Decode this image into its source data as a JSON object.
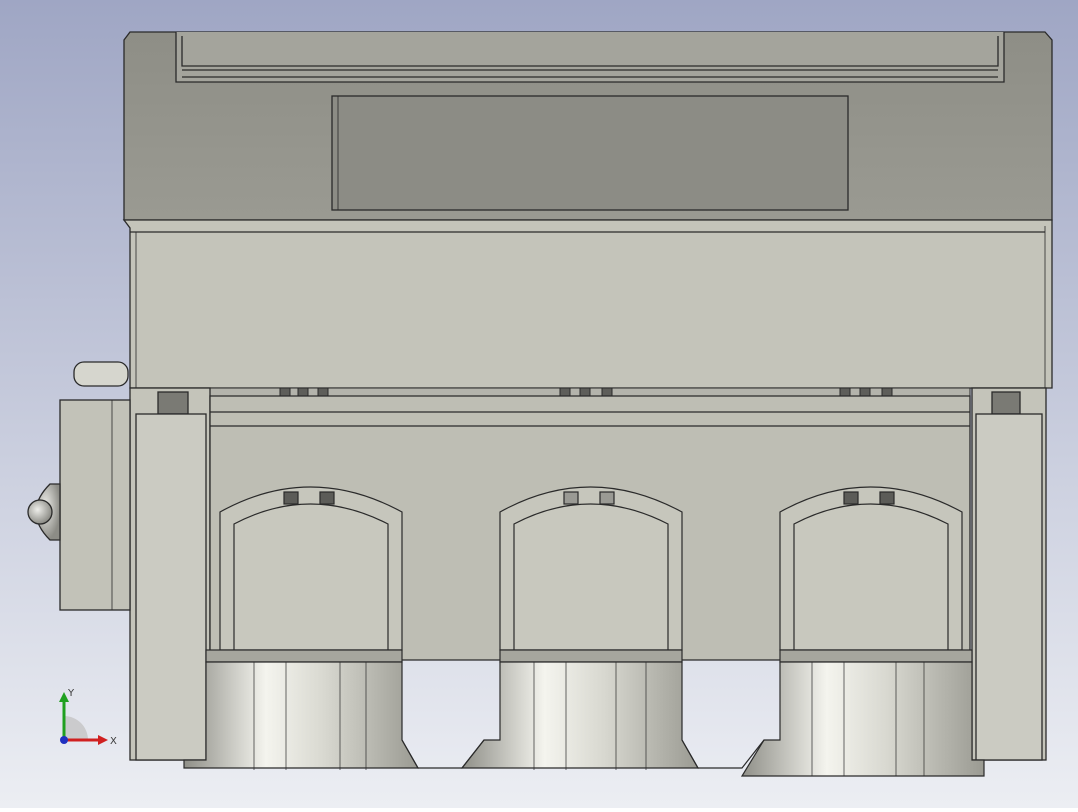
{
  "viewport": {
    "background_top": "#9fa6c4",
    "background_bottom": "#eceef3",
    "part_light": "#c5c5bb",
    "part_mid": "#a8a8a0",
    "part_dark": "#8e8e88",
    "edge": "#2a2a2a"
  },
  "triad": {
    "x_label": "X",
    "y_label": "Y",
    "x_color": "#d02020",
    "y_color": "#20a020",
    "z_color": "#2030c0"
  }
}
